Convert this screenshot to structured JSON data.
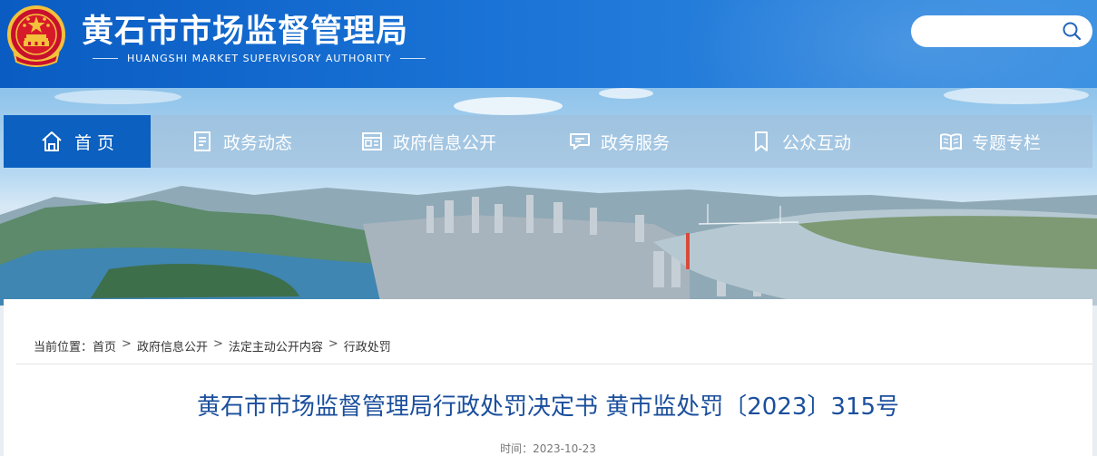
{
  "header": {
    "title": "黄石市市场监督管理局",
    "subtitle": "HUANGSHI MARKET SUPERVISORY AUTHORITY",
    "emblem": "national-emblem",
    "search": {
      "placeholder": "",
      "icon": "search-icon"
    }
  },
  "nav": {
    "items": [
      {
        "label": "首 页",
        "icon": "home-icon",
        "active": true
      },
      {
        "label": "政务动态",
        "icon": "document-list-icon"
      },
      {
        "label": "政府信息公开",
        "icon": "newspaper-icon"
      },
      {
        "label": "政务服务",
        "icon": "chat-service-icon"
      },
      {
        "label": "公众互动",
        "icon": "bookmark-icon"
      },
      {
        "label": "专题专栏",
        "icon": "open-book-icon"
      }
    ]
  },
  "breadcrumb": {
    "prefix": "当前位置：",
    "items": [
      "首页",
      "政府信息公开",
      "法定主动公开内容",
      "行政处罚"
    ],
    "separator": ">"
  },
  "article": {
    "title": "黄石市市场监督管理局行政处罚决定书 黄市监处罚〔2023〕315号",
    "time": "时间：2023-10-23"
  },
  "colors": {
    "header_blue": "#1167cb",
    "nav_active": "#0b60c0",
    "title_blue": "#1b4f9c"
  }
}
